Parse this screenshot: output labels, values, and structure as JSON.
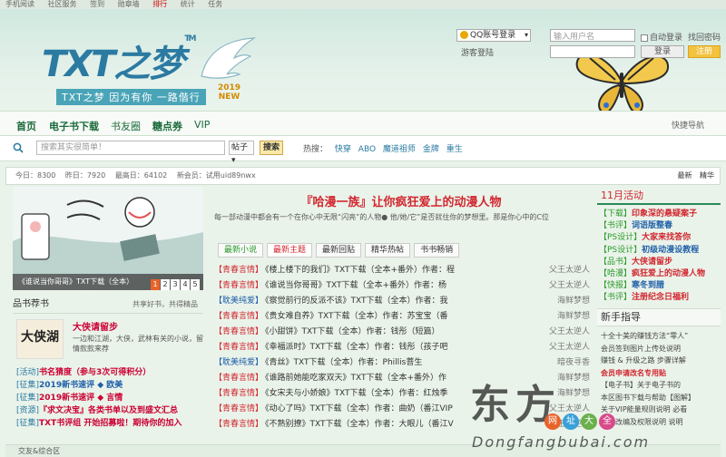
{
  "topbar": {
    "items": [
      "手机阅读",
      "社区服务",
      "签到",
      "勋章墙",
      "排行",
      "统计",
      "任务"
    ]
  },
  "header": {
    "logo_text": "TXT之梦",
    "logo_tm": "TM",
    "slogan": "TXT之梦 因为有你 一路偕行",
    "year": "2019",
    "year_label": "NEW"
  },
  "login": {
    "qq_label": "QQ账号登录",
    "quick_label": "游客登陆",
    "username_placeholder": "输入用户名",
    "remember_label": "自动登录",
    "find_label": "找回密码",
    "login_button": "登录",
    "register_button": "注册"
  },
  "nav": {
    "items": [
      "首页",
      "电子书下载",
      "书友圈",
      "糖点券",
      "VIP"
    ],
    "quick_nav": "快捷导航"
  },
  "search": {
    "placeholder": "搜索其实很简单！",
    "type_label": "帖子",
    "button": "搜索",
    "hot_label": "热搜：",
    "hot_keys": [
      "快穿",
      "ABO",
      "魔道祖师",
      "金牌",
      "重生"
    ]
  },
  "stats": {
    "today": "今日：8300",
    "yesterday": "昨日：7920",
    "max": "最高日：64102",
    "new_member": "新会员：试用uid89nwx",
    "right_links": [
      "最新",
      "精华"
    ]
  },
  "banner": {
    "caption": "《谁说当你哥哥》TXT下载（全本）",
    "pages": [
      "1",
      "2",
      "3",
      "4",
      "5"
    ]
  },
  "recommend": {
    "title": "品书荐书",
    "more": "共享好书，共得精品",
    "book_cover_text": "大侠湖",
    "book_title": "大侠请留步",
    "book_desc": "一边和江湖，大侠，武林有关的小说，留情款款来荐",
    "links": [
      {
        "tag": "[活动]",
        "text": "书名猜度（参与3次可得积分）",
        "blue": false
      },
      {
        "tag": "[征集]",
        "text": "2019新书速评 ◆ 欧美",
        "blue": true
      },
      {
        "tag": "[征集]",
        "text": "2019新书速评 ◆ 言情",
        "blue": false
      },
      {
        "tag": "[资源]",
        "text": "『求文决宝』各类书单以及到盛文汇总",
        "blue": false
      },
      {
        "tag": "[征集]",
        "text": "TXT书评组 开始招募啦！期待你的加入",
        "blue": false
      }
    ]
  },
  "feature": {
    "title": "『哈漫一族』让你疯狂爱上的动漫人物",
    "desc": "每一部动漫中都会有一个在你心中无限“闪亮”的人物● 他/她/它”是否就住你的梦想里。那是你心中的C位",
    "tabs": [
      "最新小说",
      "最新主题",
      "最新回贴",
      "精华热帖",
      "书书畅销"
    ]
  },
  "threads": [
    {
      "cat": "【青春言情】",
      "title": "《楼上楼下的我们》TXT下载（全本+番外）作者：程",
      "author": "父王太逆人"
    },
    {
      "cat": "【青春言情】",
      "title": "《谁说当你哥哥》TXT下载（全本+番外）作者：杨",
      "author": "父王太逆人"
    },
    {
      "cat": "【耽美纯爱】",
      "title": "《察觉前行的反派不该》TXT下载（全本）作者：我",
      "author": "海鲜梦想"
    },
    {
      "cat": "【青春言情】",
      "title": "《贵女难自养》TXT下载（全本）作者：苏宝宝（番",
      "author": "海鲜梦想"
    },
    {
      "cat": "【青春言情】",
      "title": "《小甜饼》TXT下载（全本）作者：钱彤（短篇）",
      "author": "父王太逆人"
    },
    {
      "cat": "【青春言情】",
      "title": "《幸福派时》TXT下载（全本）作者：钱彤（孩子吧",
      "author": "父王太逆人"
    },
    {
      "cat": "【耽美纯爱】",
      "title": "《青丝》TXT下载（全本）作者：Phillis菩生",
      "author": "暗夜寻香"
    },
    {
      "cat": "【青春言情】",
      "title": "《谁路前她能吃家双天》TXT下载（全本+番外）作",
      "author": "海鲜梦想"
    },
    {
      "cat": "【青春言情】",
      "title": "《女宋夫与小娇娘》TXT下载（全本）作者：红烛季",
      "author": "海鲜梦想"
    },
    {
      "cat": "【青春言情】",
      "title": "《动心了吗》TXT下载（全本）作者：曲奶（番江VIP",
      "author": "父王太逆人"
    },
    {
      "cat": "【青春言情】",
      "title": "《不熟别撩》TXT下载（全本）作者：大眼儿（番江V",
      "author": "父王太逆人"
    }
  ],
  "activity": {
    "title": "11月活动",
    "items": [
      {
        "k": "【下载】",
        "v": "印象深的悬疑案子",
        "blue": false
      },
      {
        "k": "【书评】",
        "v": "词语版整春",
        "blue": true
      },
      {
        "k": "【PS设计】",
        "v": "大家来找答你",
        "blue": false
      },
      {
        "k": "【PS设计】",
        "v": "初级动漫设教程",
        "blue": true
      },
      {
        "k": "【品书】",
        "v": "大侠请留步",
        "blue": false
      },
      {
        "k": "【哈漫】",
        "v": "疯狂爱上的动漫人物",
        "blue": false
      },
      {
        "k": "【快报】",
        "v": "寒冬到腊",
        "blue": true
      },
      {
        "k": "【书评】",
        "v": "注册纪念日福利",
        "blue": false
      }
    ]
  },
  "guide": {
    "title": "新手指导",
    "items": [
      {
        "text": "十全十美的赚钱方法“零人”",
        "red": false
      },
      {
        "text": "会员签到图片上传处说明",
        "red": false
      },
      {
        "text": "赚钱 & 升级之路 步骤详解",
        "red": false
      },
      {
        "text": "会员申请改名专用贴",
        "red": true
      },
      {
        "text": "【电子书】关于电子书的",
        "red": false
      },
      {
        "text": "本区图书下载与帮助【图解】",
        "red": false
      },
      {
        "text": "关于VIP能量规则说明 必看",
        "red": false
      },
      {
        "text": "小说改编及权限说明 说明",
        "red": false
      }
    ]
  },
  "section_bar": "交友&综合区",
  "watermark": {
    "cn": "东方",
    "en": "Dongfangbubai.com",
    "badges": [
      "网",
      "址",
      "大",
      "全"
    ]
  }
}
